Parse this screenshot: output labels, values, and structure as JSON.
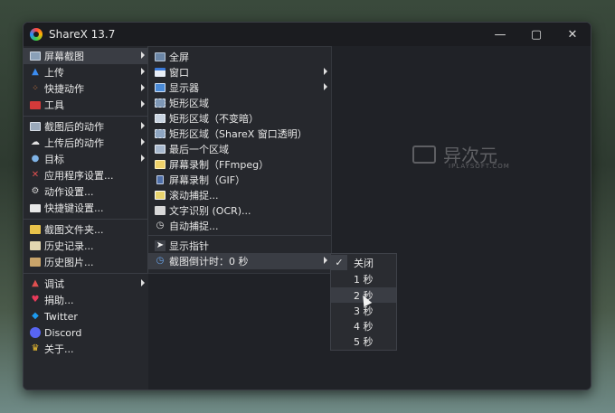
{
  "window": {
    "title": "ShareX 13.7"
  },
  "controls": {
    "minimize": "—",
    "maximize": "▢",
    "close": "✕"
  },
  "main_menu": [
    {
      "label": "屏幕截图",
      "icon": "monitor-icon",
      "submenu": true
    },
    {
      "label": "上传",
      "icon": "upload-arrow-icon",
      "submenu": true
    },
    {
      "label": "快捷动作",
      "icon": "grid-dots-icon",
      "submenu": true
    },
    {
      "label": "工具",
      "icon": "toolbox-icon",
      "submenu": true
    },
    {
      "label": "截图后的动作",
      "icon": "monitor-action-icon",
      "submenu": true
    },
    {
      "label": "上传后的动作",
      "icon": "cloud-icon",
      "submenu": true
    },
    {
      "label": "目标",
      "icon": "user-target-icon",
      "submenu": true
    },
    {
      "label": "应用程序设置...",
      "icon": "wrench-icon",
      "submenu": false
    },
    {
      "label": "动作设置...",
      "icon": "gear-icon",
      "submenu": false
    },
    {
      "label": "快捷键设置...",
      "icon": "keyboard-icon",
      "submenu": false
    },
    {
      "label": "截图文件夹...",
      "icon": "folder-icon",
      "submenu": false
    },
    {
      "label": "历史记录...",
      "icon": "history-icon",
      "submenu": false
    },
    {
      "label": "历史图片...",
      "icon": "image-history-icon",
      "submenu": false
    },
    {
      "label": "调试",
      "icon": "debug-icon",
      "submenu": true
    },
    {
      "label": "捐助...",
      "icon": "heart-icon",
      "submenu": false
    },
    {
      "label": "Twitter",
      "icon": "twitter-icon",
      "submenu": false
    },
    {
      "label": "Discord",
      "icon": "discord-icon",
      "submenu": false
    },
    {
      "label": "关于...",
      "icon": "crown-icon",
      "submenu": false
    }
  ],
  "capture_menu": [
    {
      "label": "全屏",
      "icon": "fullscreen-icon",
      "submenu": false
    },
    {
      "label": "窗口",
      "icon": "window-icon",
      "submenu": true
    },
    {
      "label": "显示器",
      "icon": "display-icon",
      "submenu": true
    },
    {
      "label": "矩形区域",
      "icon": "rectangle-icon",
      "submenu": false
    },
    {
      "label": "矩形区域（不变暗）",
      "icon": "rectangle-light-icon",
      "submenu": false
    },
    {
      "label": "矩形区域（ShareX 窗口透明）",
      "icon": "rectangle-transparent-icon",
      "submenu": false
    },
    {
      "label": "最后一个区域",
      "icon": "last-region-icon",
      "submenu": false
    },
    {
      "label": "屏幕录制（FFmpeg）",
      "icon": "video-record-icon",
      "submenu": false
    },
    {
      "label": "屏幕录制（GIF）",
      "icon": "gif-record-icon",
      "submenu": false
    },
    {
      "label": "滚动捕捉...",
      "icon": "scroll-capture-icon",
      "submenu": false
    },
    {
      "label": "文字识别 (OCR)...",
      "icon": "ocr-icon",
      "submenu": false
    },
    {
      "label": "自动捕捉...",
      "icon": "clock-icon",
      "submenu": false
    },
    {
      "label": "显示指针",
      "icon": "pointer-icon",
      "submenu": false
    },
    {
      "label": "截图倒计时：0 秒",
      "icon": "timer-icon",
      "submenu": true
    }
  ],
  "timer_menu": [
    {
      "label": "关闭",
      "checked": true
    },
    {
      "label": "1 秒",
      "checked": false
    },
    {
      "label": "2 秒",
      "checked": false
    },
    {
      "label": "3 秒",
      "checked": false
    },
    {
      "label": "4 秒",
      "checked": false
    },
    {
      "label": "5 秒",
      "checked": false
    }
  ],
  "watermark": {
    "text": "异次元",
    "sub": "IPLAYSOFT.COM"
  },
  "colors": {
    "menu_bg": "#26282d",
    "highlight": "#3a3d44",
    "text": "#e8e8e8"
  }
}
